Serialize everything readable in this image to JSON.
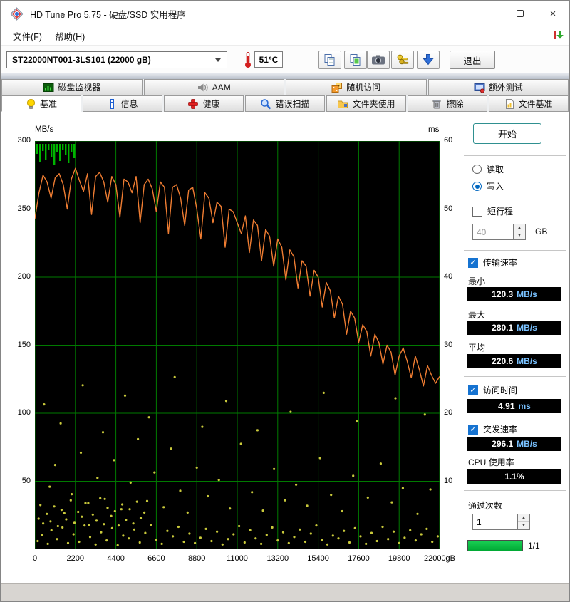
{
  "window": {
    "title": "HD Tune Pro 5.75 - 硬盘/SSD 实用程序"
  },
  "menu": {
    "file": "文件(F)",
    "help": "帮助(H)"
  },
  "toolbar": {
    "drive": "ST22000NT001-3LS101 (22000 gB)",
    "temperature": "51°C",
    "exit": "退出"
  },
  "tabs_row1": [
    {
      "label": "磁盘监视器"
    },
    {
      "label": "AAM"
    },
    {
      "label": "随机访问"
    },
    {
      "label": "额外测试"
    }
  ],
  "tabs_row2": [
    {
      "label": "基准"
    },
    {
      "label": "信息"
    },
    {
      "label": "健康"
    },
    {
      "label": "错误扫描"
    },
    {
      "label": "文件夹使用"
    },
    {
      "label": "擦除"
    },
    {
      "label": "文件基准"
    }
  ],
  "panel": {
    "start": "开始",
    "read": "读取",
    "write": "写入",
    "short_stroke": "短行程",
    "short_stroke_value": "40",
    "gb_unit": "GB",
    "transfer_rate": "传输速率",
    "min_label": "最小",
    "min_num": "120.3",
    "min_unit": "MB/s",
    "max_label": "最大",
    "max_num": "280.1",
    "max_unit": "MB/s",
    "avg_label": "平均",
    "avg_num": "220.6",
    "avg_unit": "MB/s",
    "access_label": "访问时间",
    "access_num": "4.91",
    "access_unit": "ms",
    "burst_label": "突发速率",
    "burst_num": "296.1",
    "burst_unit": "MB/s",
    "cpu_label": "CPU 使用率",
    "cpu_num": "1.1%",
    "cpu_unit": "",
    "pass_label": "通过次数",
    "pass_value": "1",
    "progress_text": "1/1"
  },
  "chart_data": {
    "type": "line",
    "title": "HD Tune write benchmark",
    "bg": "#000000",
    "grid_color": "#007a00",
    "corner_color": "#00b400",
    "y_left_label": "MB/s",
    "y_right_label": "ms",
    "y_left_ticks": [
      300,
      250,
      200,
      150,
      100,
      50
    ],
    "y_right_ticks": [
      60,
      50,
      40,
      30,
      20,
      10
    ],
    "y_left_range": [
      0,
      300
    ],
    "y_right_range": [
      0,
      60
    ],
    "x_range": [
      0,
      22000
    ],
    "x_ticks": [
      "0",
      "2200",
      "4400",
      "6600",
      "8800",
      "11000",
      "13200",
      "15400",
      "17600",
      "19800",
      "22000gB"
    ],
    "x_step_gb": 220,
    "series": [
      {
        "name": "transfer_rate_mb_s",
        "color": "#ef7d32",
        "values": [
          243,
          262,
          275,
          270,
          258,
          273,
          276,
          268,
          250,
          272,
          280,
          271,
          263,
          276,
          246,
          274,
          277,
          270,
          255,
          274,
          268,
          244,
          272,
          270,
          262,
          274,
          240,
          268,
          272,
          265,
          248,
          270,
          266,
          232,
          266,
          268,
          258,
          238,
          264,
          266,
          250,
          228,
          262,
          258,
          240,
          255,
          252,
          222,
          250,
          248,
          240,
          232,
          245,
          218,
          242,
          238,
          212,
          235,
          230,
          208,
          228,
          222,
          198,
          220,
          215,
          192,
          212,
          208,
          186,
          205,
          200,
          178,
          196,
          190,
          170,
          186,
          180,
          158,
          175,
          170,
          152,
          165,
          160,
          142,
          158,
          152,
          136,
          150,
          145,
          128,
          142,
          148,
          138,
          126,
          142,
          132,
          120,
          135,
          128,
          122,
          127
        ]
      }
    ],
    "access_dots": {
      "name": "access_time_ms",
      "color": "#c9c93b",
      "points": [
        [
          150,
          1.2
        ],
        [
          400,
          2.1
        ],
        [
          700,
          0.8
        ],
        [
          900,
          2.8
        ],
        [
          1200,
          1.5
        ],
        [
          1500,
          3.2
        ],
        [
          1800,
          0.9
        ],
        [
          2100,
          2.2
        ],
        [
          2400,
          1.1
        ],
        [
          2700,
          3.5
        ],
        [
          3000,
          1.8
        ],
        [
          3300,
          0.7
        ],
        [
          3600,
          2.5
        ],
        [
          3900,
          1.3
        ],
        [
          4200,
          3.1
        ],
        [
          4500,
          0.6
        ],
        [
          4800,
          2.0
        ],
        [
          5100,
          1.6
        ],
        [
          5400,
          2.9
        ],
        [
          5700,
          1.0
        ],
        [
          6000,
          2.4
        ],
        [
          6300,
          3.6
        ],
        [
          6600,
          1.4
        ],
        [
          6900,
          0.8
        ],
        [
          7200,
          2.7
        ],
        [
          7500,
          1.9
        ],
        [
          7800,
          3.3
        ],
        [
          8100,
          1.1
        ],
        [
          8400,
          2.3
        ],
        [
          8700,
          0.9
        ],
        [
          9000,
          1.7
        ],
        [
          9300,
          3.0
        ],
        [
          9600,
          1.2
        ],
        [
          9900,
          2.6
        ],
        [
          10200,
          0.7
        ],
        [
          10500,
          1.5
        ],
        [
          10800,
          2.2
        ],
        [
          11100,
          3.4
        ],
        [
          11400,
          1.0
        ],
        [
          11700,
          2.8
        ],
        [
          12000,
          1.6
        ],
        [
          12300,
          0.8
        ],
        [
          12600,
          2.1
        ],
        [
          12900,
          3.2
        ],
        [
          13200,
          1.3
        ],
        [
          13500,
          2.5
        ],
        [
          13800,
          0.9
        ],
        [
          14100,
          1.8
        ],
        [
          14400,
          2.9
        ],
        [
          14700,
          1.1
        ],
        [
          15000,
          2.3
        ],
        [
          15300,
          3.5
        ],
        [
          15600,
          1.4
        ],
        [
          15900,
          0.7
        ],
        [
          16200,
          2.0
        ],
        [
          16500,
          1.6
        ],
        [
          16800,
          2.7
        ],
        [
          17100,
          1.0
        ],
        [
          17400,
          3.1
        ],
        [
          17700,
          1.9
        ],
        [
          18000,
          0.8
        ],
        [
          18300,
          2.4
        ],
        [
          18600,
          1.2
        ],
        [
          18900,
          3.3
        ],
        [
          19200,
          1.5
        ],
        [
          19500,
          2.6
        ],
        [
          19800,
          0.9
        ],
        [
          20100,
          1.7
        ],
        [
          20400,
          2.8
        ],
        [
          20700,
          1.3
        ],
        [
          21000,
          2.2
        ],
        [
          21300,
          3.0
        ],
        [
          21600,
          1.1
        ],
        [
          21900,
          1.9
        ],
        [
          200,
          4.5
        ],
        [
          450,
          3.8
        ],
        [
          650,
          5.2
        ],
        [
          850,
          4.1
        ],
        [
          1050,
          6.3
        ],
        [
          1250,
          3.4
        ],
        [
          1450,
          5.8
        ],
        [
          1700,
          4.4
        ],
        [
          1950,
          7.2
        ],
        [
          2150,
          3.9
        ],
        [
          2350,
          5.5
        ],
        [
          2550,
          4.8
        ],
        [
          2750,
          6.8
        ],
        [
          2950,
          3.6
        ],
        [
          3150,
          5.1
        ],
        [
          3350,
          4.2
        ],
        [
          3550,
          7.5
        ],
        [
          3750,
          3.7
        ],
        [
          3950,
          6.1
        ],
        [
          4150,
          4.9
        ],
        [
          4350,
          5.6
        ],
        [
          4550,
          3.5
        ],
        [
          4750,
          6.6
        ],
        [
          4950,
          4.3
        ],
        [
          5150,
          5.9
        ],
        [
          5350,
          3.8
        ],
        [
          5550,
          7.0
        ],
        [
          5750,
          4.6
        ],
        [
          5950,
          5.4
        ],
        [
          300,
          6.5
        ],
        [
          800,
          9.2
        ],
        [
          1100,
          12.4
        ],
        [
          1600,
          5.3
        ],
        [
          2000,
          8.1
        ],
        [
          2500,
          14.2
        ],
        [
          2900,
          6.8
        ],
        [
          3400,
          10.5
        ],
        [
          3800,
          7.4
        ],
        [
          4300,
          13.1
        ],
        [
          4700,
          5.9
        ],
        [
          5200,
          9.8
        ],
        [
          5600,
          16.2
        ],
        [
          6100,
          7.1
        ],
        [
          6500,
          11.3
        ],
        [
          7000,
          6.2
        ],
        [
          7400,
          14.8
        ],
        [
          7900,
          8.6
        ],
        [
          8300,
          5.4
        ],
        [
          8800,
          12.0
        ],
        [
          9400,
          7.8
        ],
        [
          10000,
          10.2
        ],
        [
          10600,
          6.0
        ],
        [
          11200,
          15.5
        ],
        [
          11800,
          8.4
        ],
        [
          12400,
          5.7
        ],
        [
          13000,
          11.8
        ],
        [
          13600,
          7.2
        ],
        [
          14200,
          9.5
        ],
        [
          14800,
          6.4
        ],
        [
          15500,
          13.4
        ],
        [
          16100,
          8.0
        ],
        [
          16700,
          5.6
        ],
        [
          17300,
          10.8
        ],
        [
          18100,
          7.6
        ],
        [
          18800,
          12.6
        ],
        [
          19400,
          6.9
        ],
        [
          20000,
          9.0
        ],
        [
          20800,
          5.2
        ],
        [
          21500,
          8.8
        ],
        [
          500,
          21.3
        ],
        [
          1400,
          18.5
        ],
        [
          2600,
          24.1
        ],
        [
          3700,
          17.2
        ],
        [
          4900,
          22.6
        ],
        [
          6200,
          19.4
        ],
        [
          7600,
          25.3
        ],
        [
          9100,
          18.0
        ],
        [
          10400,
          21.8
        ],
        [
          12100,
          17.5
        ],
        [
          13900,
          20.2
        ],
        [
          15700,
          23.0
        ],
        [
          17500,
          18.8
        ],
        [
          19600,
          22.2
        ],
        [
          21200,
          19.8
        ]
      ]
    },
    "corner_bars": [
      [
        2,
        14
      ],
      [
        6,
        26
      ],
      [
        10,
        10
      ],
      [
        14,
        22
      ],
      [
        18,
        8
      ],
      [
        22,
        18
      ],
      [
        26,
        30
      ],
      [
        30,
        12
      ],
      [
        34,
        24
      ],
      [
        38,
        9
      ],
      [
        42,
        16
      ],
      [
        46,
        27
      ],
      [
        50,
        11
      ],
      [
        54,
        20
      ]
    ]
  }
}
